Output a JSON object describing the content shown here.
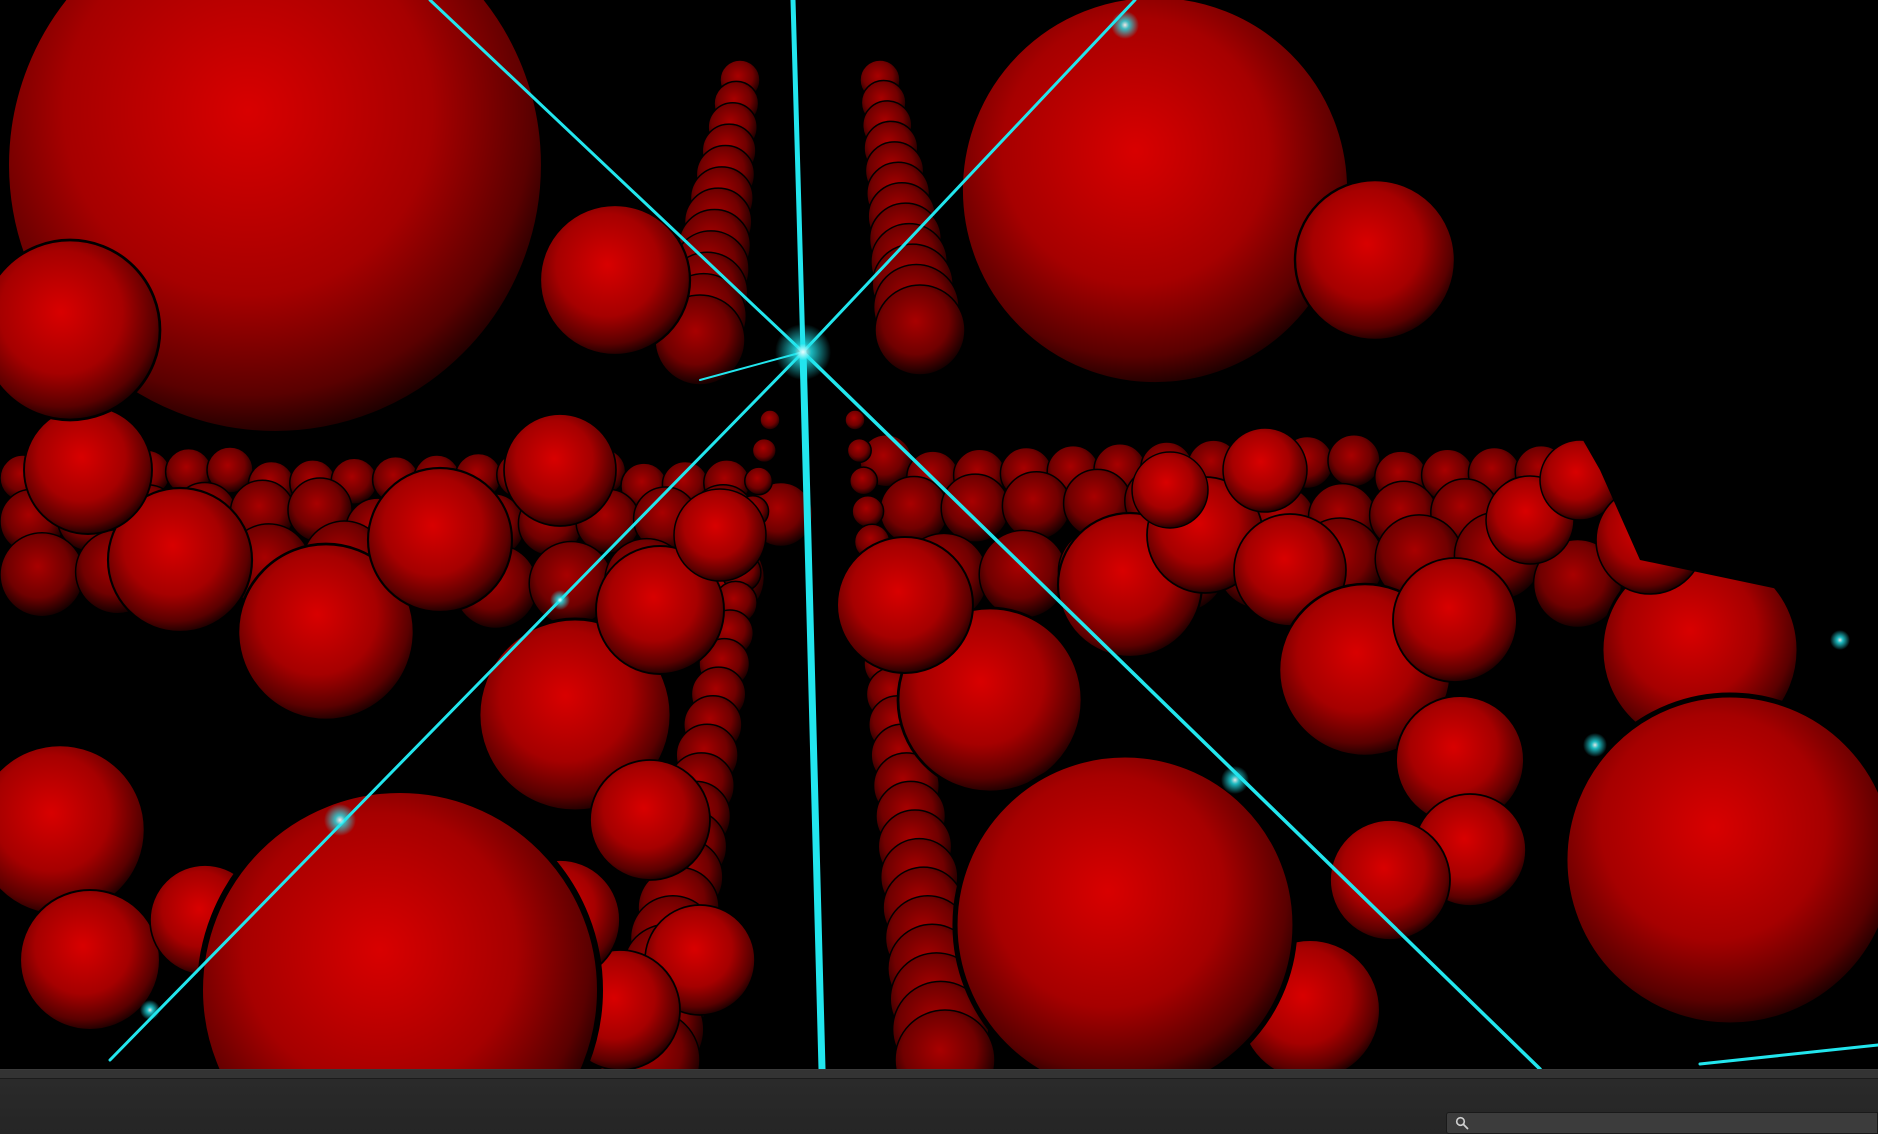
{
  "viewport": {
    "background": "#000000",
    "sphere_color": "#cc0000",
    "sphere_highlight": "#e00000",
    "sphere_shadow": "#1a0000",
    "ray_color": "#22e6ee"
  },
  "toolbar": {
    "background": "#2b2b2b"
  },
  "search": {
    "value": "",
    "placeholder": "",
    "icon": "magnifier-icon"
  }
}
